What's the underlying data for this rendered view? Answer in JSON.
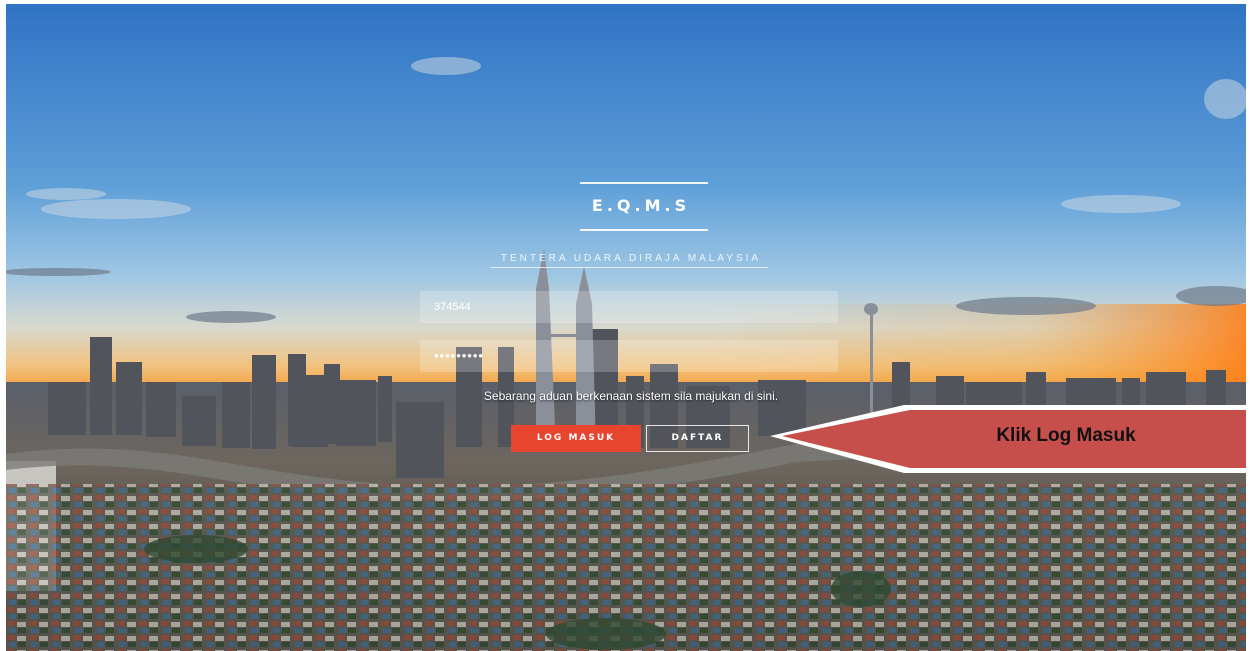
{
  "login": {
    "title": "E.Q.M.S",
    "organization": "TENTERA UDARA DIRAJA MALAYSIA",
    "username_value": "374544",
    "password_value": "•••••••••",
    "notice": "Sebarang aduan berkenaan sistem sila majukan di sini.",
    "login_button": "LOG MASUK",
    "register_button": "DAFTAR"
  },
  "annotation": {
    "label": "Klik Log Masuk"
  },
  "colors": {
    "login_button": "#e8452e",
    "callout_fill": "#c64f4b",
    "sky_top": "#2f73c4",
    "sunset": "#f39a33"
  }
}
